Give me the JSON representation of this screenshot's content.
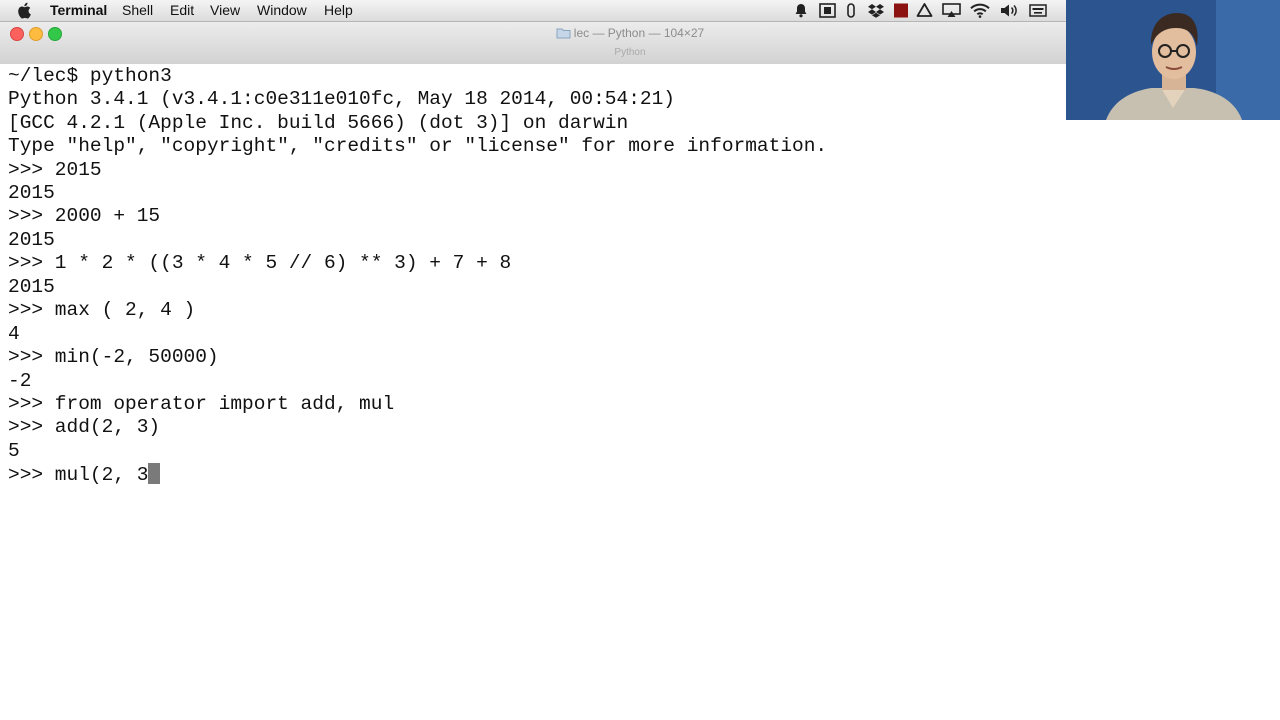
{
  "menubar": {
    "app_name": "Terminal",
    "items": [
      "Shell",
      "Edit",
      "View",
      "Window",
      "Help"
    ],
    "status_icons": [
      "bell-icon",
      "scan-icon",
      "battery-icon",
      "dropbox-icon",
      "red-square-icon",
      "drive-icon",
      "airplay-icon",
      "wifi-icon",
      "volume-icon",
      "keyboard-icon"
    ]
  },
  "window": {
    "title": "lec — Python — 104×27",
    "subtitle": "Python"
  },
  "terminal": {
    "lines": [
      "~/lec$ python3",
      "Python 3.4.1 (v3.4.1:c0e311e010fc, May 18 2014, 00:54:21)",
      "[GCC 4.2.1 (Apple Inc. build 5666) (dot 3)] on darwin",
      "Type \"help\", \"copyright\", \"credits\" or \"license\" for more information.",
      ">>> 2015",
      "2015",
      ">>> 2000 + 15",
      "2015",
      ">>> 1 * 2 * ((3 * 4 * 5 // 6) ** 3) + 7 + 8",
      "2015",
      ">>> max ( 2, 4 )",
      "4",
      ">>> min(-2, 50000)",
      "-2",
      ">>> from operator import add, mul",
      ">>> add(2, 3)",
      "5",
      ">>> mul(2, 3"
    ]
  },
  "colors": {
    "terminal_bg": "#ffffff",
    "terminal_text": "#111111",
    "cursor": "#7a7a7a",
    "close_button": "#fc615d",
    "minimize_button": "#fdbc40",
    "zoom_button": "#34c84a"
  }
}
